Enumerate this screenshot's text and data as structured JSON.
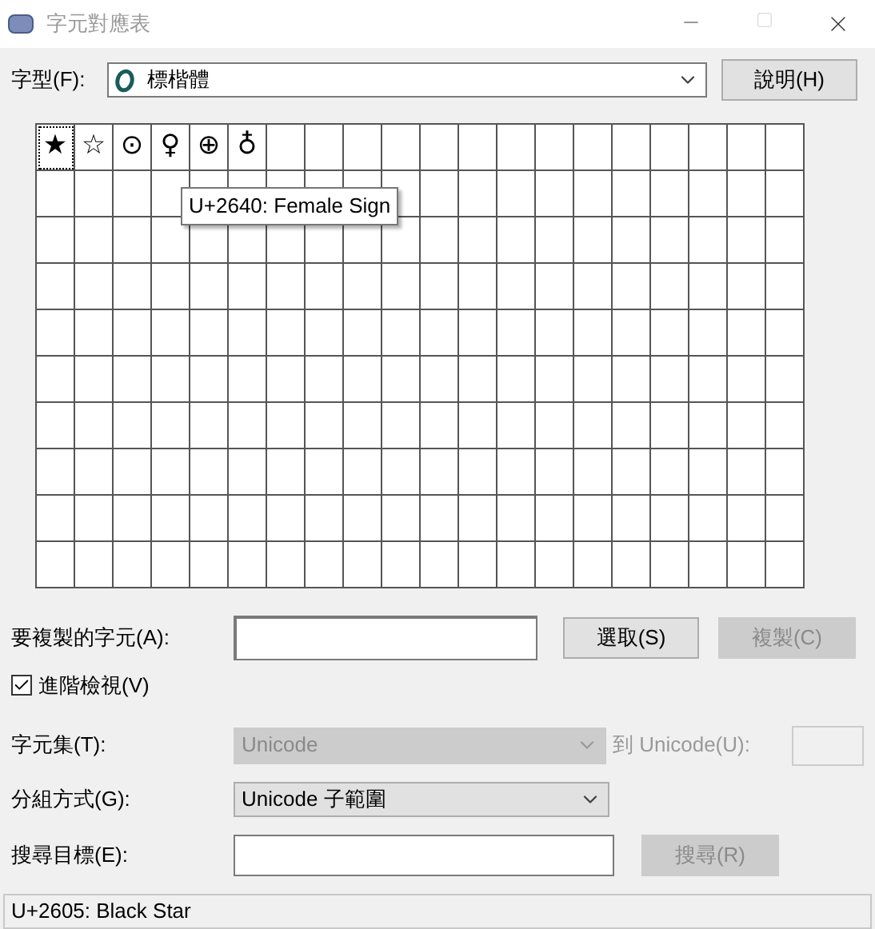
{
  "window": {
    "title": "字元對應表"
  },
  "font": {
    "label": "字型(F):",
    "value": "標楷體",
    "help_button": "說明(H)"
  },
  "grid": {
    "cells": [
      {
        "char": "★",
        "selected": true
      },
      {
        "char": "☆",
        "selected": false
      },
      {
        "char": "⊙",
        "selected": false
      },
      {
        "char": "♀",
        "selected": false
      },
      {
        "char": "⊕",
        "selected": false
      },
      {
        "char": "♁",
        "selected": false
      }
    ],
    "tooltip": "U+2640: Female Sign"
  },
  "copy": {
    "label": "要複製的字元(A):",
    "select_button": "選取(S)",
    "copy_button": "複製(C)",
    "copy_disabled": true
  },
  "advanced": {
    "label": "進階檢視(V)",
    "checked": true
  },
  "charset": {
    "label": "字元集(T):",
    "value": "Unicode",
    "disabled": true,
    "goto_label": "到 Unicode(U):"
  },
  "group": {
    "label": "分組方式(G):",
    "value": "Unicode 子範圍"
  },
  "search": {
    "label": "搜尋目標(E):",
    "button": "搜尋(R)",
    "button_disabled": true
  },
  "status_bar": "U+2605: Black Star"
}
